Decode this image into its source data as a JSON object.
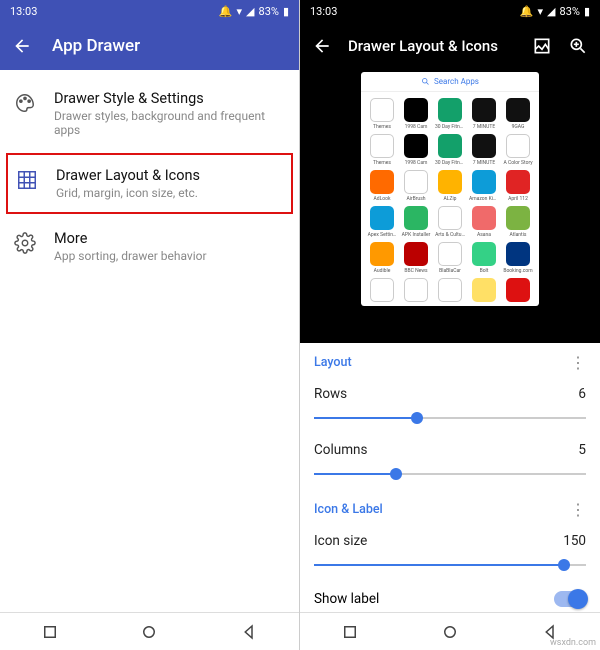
{
  "status": {
    "time": "13:03",
    "battery": "83%"
  },
  "left": {
    "title": "App Drawer",
    "items": [
      {
        "title": "Drawer Style & Settings",
        "sub": "Drawer styles, background and frequent apps"
      },
      {
        "title": "Drawer Layout & Icons",
        "sub": "Grid, margin, icon size, etc."
      },
      {
        "title": "More",
        "sub": "App sorting, drawer behavior"
      }
    ]
  },
  "right": {
    "title": "Drawer Layout & Icons",
    "preview": {
      "search": "Search Apps",
      "rows": [
        [
          {
            "lbl": "Themes",
            "c": "#fff",
            "b": "1"
          },
          {
            "lbl": "1998 Cam",
            "c": "#000"
          },
          {
            "lbl": "30 Day Fitne…",
            "c": "#13a06a"
          },
          {
            "lbl": "7 MINUTE",
            "c": "#111"
          },
          {
            "lbl": "9GAG",
            "c": "#111"
          }
        ],
        [
          {
            "lbl": "Themes",
            "c": "#fff",
            "b": "1"
          },
          {
            "lbl": "1998 Cam",
            "c": "#000"
          },
          {
            "lbl": "30 Day Fitne…",
            "c": "#13a06a"
          },
          {
            "lbl": "7 MINUTE",
            "c": "#111"
          },
          {
            "lbl": "A Color Story",
            "c": "#fff",
            "b": "1"
          }
        ],
        [
          {
            "lbl": "AdLook",
            "c": "#ff6a00"
          },
          {
            "lbl": "AirBrush",
            "c": "#fff",
            "b": "1"
          },
          {
            "lbl": "ALZip",
            "c": "#ffb300"
          },
          {
            "lbl": "Amazon Kin…",
            "c": "#0d9cd8"
          },
          {
            "lbl": "April 112",
            "c": "#e02424"
          }
        ],
        [
          {
            "lbl": "Apex Settin…",
            "c": "#0d9cd8"
          },
          {
            "lbl": "APK Installer",
            "c": "#2bb663"
          },
          {
            "lbl": "Arts & Cultu…",
            "c": "#fff",
            "b": "1"
          },
          {
            "lbl": "Asana",
            "c": "#f06a6a"
          },
          {
            "lbl": "Atlantis",
            "c": "#7cb342"
          }
        ],
        [
          {
            "lbl": "Audible",
            "c": "#ff9900"
          },
          {
            "lbl": "BBC News",
            "c": "#b00"
          },
          {
            "lbl": "BlaBlaCar",
            "c": "#fff",
            "b": "1"
          },
          {
            "lbl": "Bolt",
            "c": "#34d186"
          },
          {
            "lbl": "Booking.com",
            "c": "#003580"
          }
        ],
        [
          {
            "lbl": "",
            "c": "#fff",
            "b": "1"
          },
          {
            "lbl": "",
            "c": "#fff",
            "b": "1"
          },
          {
            "lbl": "",
            "c": "#fff",
            "b": "1"
          },
          {
            "lbl": "",
            "c": "#ffe066"
          },
          {
            "lbl": "",
            "c": "#d11"
          }
        ]
      ]
    },
    "sections": {
      "layout": "Layout",
      "iconlabel": "Icon & Label"
    },
    "rows": {
      "label": "Rows",
      "value": "6",
      "pct": 38
    },
    "cols": {
      "label": "Columns",
      "value": "5",
      "pct": 30
    },
    "iconsize": {
      "label": "Icon size",
      "value": "150",
      "pct": 92
    },
    "showlabel": {
      "label": "Show label",
      "on": true
    }
  },
  "watermark": "wsxdn.com"
}
